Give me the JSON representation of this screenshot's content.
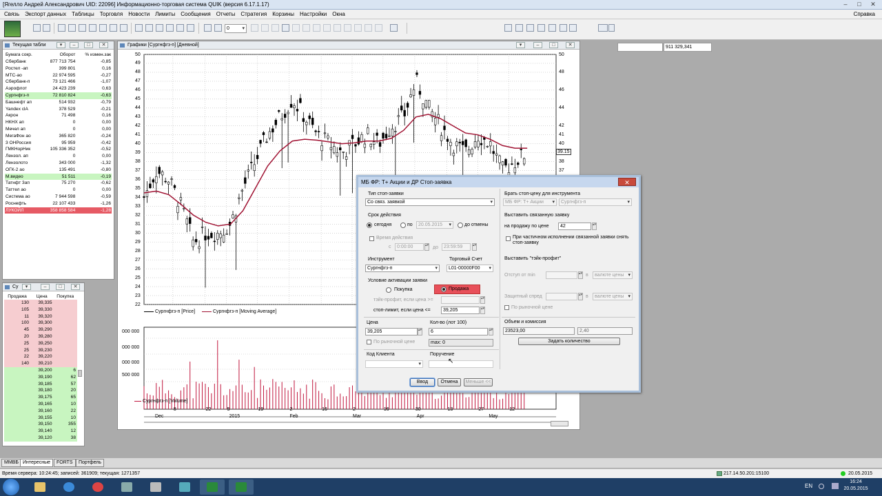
{
  "app": {
    "title": "[Ягелло Андрей Александрович UID: 22096] Информационно-торговая система QUIK (версия 6.17.1.17)",
    "menu": [
      "Связь",
      "Экспорт данных",
      "Таблицы",
      "Торговля",
      "Новости",
      "Лимиты",
      "Сообщения",
      "Отчеты",
      "Стратегия",
      "Корзины",
      "Настройки",
      "Окна"
    ],
    "help": "Справка"
  },
  "toolbar": {
    "combo_value": "0",
    "right_value": "911 329,341"
  },
  "current_table": {
    "title": "Текущая табли",
    "headers": [
      "Бумага сокр.",
      "Оборот",
      "% измен.зак"
    ],
    "rows": [
      {
        "name": "Сбербанк",
        "turnover": "877 713 754",
        "change": "-0,85",
        "hl": ""
      },
      {
        "name": "Ростел -ап",
        "turnover": "399 801",
        "change": "0,16",
        "hl": ""
      },
      {
        "name": "МТС-ао",
        "turnover": "22 974 595",
        "change": "-0,27",
        "hl": ""
      },
      {
        "name": "Сбербанк-п",
        "turnover": "73 121 466",
        "change": "-1,07",
        "hl": ""
      },
      {
        "name": "Аэрофлот",
        "turnover": "24 423 239",
        "change": "0,63",
        "hl": ""
      },
      {
        "name": "Сургнфгз-п",
        "turnover": "72 810 824",
        "change": "-0,63",
        "hl": "green"
      },
      {
        "name": "Башнефт ап",
        "turnover": "514 932",
        "change": "-0,79",
        "hl": ""
      },
      {
        "name": "Yandex clA",
        "turnover": "378 529",
        "change": "-0,21",
        "hl": ""
      },
      {
        "name": "Акрон",
        "turnover": "71 498",
        "change": "0,16",
        "hl": ""
      },
      {
        "name": "НКНХ ап",
        "turnover": "0",
        "change": "0,00",
        "hl": ""
      },
      {
        "name": "Мечел ап",
        "turnover": "0",
        "change": "0,00",
        "hl": ""
      },
      {
        "name": "МегаФон ао",
        "turnover": "365 820",
        "change": "-0,24",
        "hl": ""
      },
      {
        "name": "3 ОНРоссия",
        "turnover": "95 959",
        "change": "-0,42",
        "hl": ""
      },
      {
        "name": "ГМКНорНик",
        "turnover": "105 336 352",
        "change": "-0,52",
        "hl": ""
      },
      {
        "name": "Лензол. ап",
        "turnover": "0",
        "change": "0,00",
        "hl": ""
      },
      {
        "name": "Лензолото",
        "turnover": "343 000",
        "change": "-1,32",
        "hl": ""
      },
      {
        "name": "ОГК-2 ао",
        "turnover": "135 491",
        "change": "-0,80",
        "hl": ""
      },
      {
        "name": "М.видео",
        "turnover": "51 511",
        "change": "-0,19",
        "hl": "green"
      },
      {
        "name": "Татнфт 3ап",
        "turnover": "75 270",
        "change": "-0,62",
        "hl": ""
      },
      {
        "name": "Таттел ао",
        "turnover": "0",
        "change": "0,00",
        "hl": ""
      },
      {
        "name": "Система ао",
        "turnover": "7 944 598",
        "change": "-0,59",
        "hl": ""
      },
      {
        "name": "Роснефть",
        "turnover": "22 107 433",
        "change": "-1,26",
        "hl": ""
      },
      {
        "name": "ЛУКОЙЛ",
        "turnover": "358 858 584",
        "change": "-1,28",
        "hl": "red"
      }
    ]
  },
  "orderbook": {
    "title": "Су",
    "headers": [
      "Продажа",
      "Цена",
      "Покупка"
    ],
    "rows": [
      {
        "sell": "130",
        "price": "39,335",
        "buy": ""
      },
      {
        "sell": "105",
        "price": "39,330",
        "buy": ""
      },
      {
        "sell": "11",
        "price": "39,320",
        "buy": ""
      },
      {
        "sell": "100",
        "price": "39,300",
        "buy": ""
      },
      {
        "sell": "45",
        "price": "39,290",
        "buy": ""
      },
      {
        "sell": "20",
        "price": "39,280",
        "buy": ""
      },
      {
        "sell": "25",
        "price": "39,250",
        "buy": ""
      },
      {
        "sell": "25",
        "price": "39,230",
        "buy": ""
      },
      {
        "sell": "22",
        "price": "39,220",
        "buy": ""
      },
      {
        "sell": "140",
        "price": "39,210",
        "buy": ""
      },
      {
        "sell": "",
        "price": "39,200",
        "buy": "6"
      },
      {
        "sell": "",
        "price": "39,190",
        "buy": "62"
      },
      {
        "sell": "",
        "price": "39,185",
        "buy": "57"
      },
      {
        "sell": "",
        "price": "39,180",
        "buy": "20"
      },
      {
        "sell": "",
        "price": "39,175",
        "buy": "65"
      },
      {
        "sell": "",
        "price": "39,165",
        "buy": "10"
      },
      {
        "sell": "",
        "price": "39,160",
        "buy": "22"
      },
      {
        "sell": "",
        "price": "39,155",
        "buy": "10"
      },
      {
        "sell": "",
        "price": "39,150",
        "buy": "355"
      },
      {
        "sell": "",
        "price": "39,140",
        "buy": "12"
      },
      {
        "sell": "",
        "price": "39,120",
        "buy": "38"
      }
    ]
  },
  "chart_window": {
    "title": "Графики [Сургнфгз-п] [Дневной]",
    "price_legend": [
      "Сургнфгз-п [Price]",
      "Сургнфгз-п [Moving Average]"
    ],
    "volume_legend": "Сургнфгз-п [Volume]",
    "volume_ticks": [
      "000 000",
      "000 000",
      "000 000",
      "500 000"
    ],
    "price_badge": "39.15",
    "price_ticks": [
      50,
      49,
      48,
      47,
      46,
      45,
      44,
      43,
      42,
      41,
      40,
      39,
      38,
      37,
      36,
      35,
      34,
      33,
      32,
      31,
      30,
      29,
      28,
      27,
      26,
      25,
      24,
      23,
      22
    ],
    "right_ticks": [
      50,
      48,
      46,
      44,
      42,
      41,
      40,
      38,
      37
    ],
    "x_days": [
      {
        "label": "8",
        "x": 0.07
      },
      {
        "label": "22",
        "x": 0.148
      },
      {
        "label": "5",
        "x": 0.2
      },
      {
        "label": "19",
        "x": 0.275
      },
      {
        "label": "2",
        "x": 0.352
      },
      {
        "label": "16",
        "x": 0.43
      },
      {
        "label": "2",
        "x": 0.505
      },
      {
        "label": "16",
        "x": 0.58
      },
      {
        "label": "30",
        "x": 0.657
      },
      {
        "label": "13",
        "x": 0.735
      },
      {
        "label": "27",
        "x": 0.81
      },
      {
        "label": "12",
        "x": 0.885
      }
    ],
    "x_months": [
      {
        "label": "Dec",
        "x": 0.025
      },
      {
        "label": "2015",
        "x": 0.205
      },
      {
        "label": "Feb",
        "x": 0.352
      },
      {
        "label": "Mar",
        "x": 0.505
      },
      {
        "label": "Apr",
        "x": 0.66
      },
      {
        "label": "May",
        "x": 0.835
      }
    ]
  },
  "chart_data": {
    "type": "line",
    "title": "",
    "ylim": [
      22,
      50
    ],
    "series": [
      {
        "name": "Сургнфгз-п [Price]",
        "x": [
          0,
          0.03,
          0.06,
          0.09,
          0.12,
          0.15,
          0.18,
          0.21,
          0.24,
          0.27,
          0.3,
          0.33,
          0.36,
          0.39,
          0.42,
          0.45,
          0.48,
          0.51,
          0.54,
          0.57,
          0.6,
          0.63,
          0.66,
          0.69,
          0.72,
          0.75,
          0.78,
          0.81,
          0.84,
          0.87,
          0.9,
          0.93
        ],
        "values": [
          34,
          37,
          36,
          33,
          29,
          30,
          30,
          31,
          35,
          38,
          41,
          43,
          45,
          43,
          41,
          40,
          39,
          40,
          41,
          40,
          42,
          43,
          47,
          44,
          42,
          40,
          39,
          41,
          40,
          37,
          38,
          39
        ]
      },
      {
        "name": "Сургнфгз-п [Moving Average]",
        "x": [
          0,
          0.03,
          0.06,
          0.09,
          0.12,
          0.15,
          0.18,
          0.21,
          0.24,
          0.27,
          0.3,
          0.33,
          0.36,
          0.39,
          0.42,
          0.45,
          0.48,
          0.51,
          0.54,
          0.57,
          0.6,
          0.63,
          0.66,
          0.69,
          0.72,
          0.75,
          0.78,
          0.81,
          0.84,
          0.87,
          0.9,
          0.93
        ],
        "values": [
          34.5,
          34.7,
          34.3,
          33.2,
          32,
          31.2,
          30.8,
          31,
          32.5,
          35,
          37.5,
          39.2,
          40.3,
          40.5,
          40.4,
          40.2,
          40,
          40.1,
          40.3,
          40.3,
          40.6,
          41.5,
          43,
          43.3,
          42.8,
          42,
          41.2,
          41,
          40.5,
          39.8,
          39.5,
          39.5
        ]
      }
    ]
  },
  "dialog": {
    "title": "МБ ФР: Т+ Акции и ДР Стоп-заявка",
    "close": "✕",
    "stop_type_label": "Тип стоп-заявки",
    "stop_type_value": "Со связ. заявкой",
    "term_label": "Срок действия",
    "today": "сегодня",
    "to": "по",
    "date_value": "20.05.2015",
    "until_cancel": "до отмены",
    "time_label": "Время действия",
    "from": "с",
    "time_from": "0:00:00",
    "till": "до",
    "time_to": "23:59:59",
    "instrument_label": "Инструмент",
    "instrument_value": "Сургнфгз-п",
    "account_label": "Торговый Счет",
    "account_value": "L01-00000F00",
    "condition_label": "Условие активации заявки",
    "buy": "Покупка",
    "sell": "Продажа",
    "take_profit_cond": "тэйк-профит, если цена >=",
    "stop_limit_cond": "стоп-лимит, если цена <=",
    "stop_price": "39,205",
    "price_label": "Цена",
    "price_value": "39,205",
    "qty_label": "Кол-во (лот 100)",
    "qty_value": "6",
    "market_price": "По рыночной цене",
    "max_label": "max: 0",
    "client_code_label": "Код Клиента",
    "comment_label": "Поручение",
    "ok": "Ввод",
    "cancel": "Отмена",
    "less": "Меньше <<",
    "take_price_label": "Брать стоп-цену для инструмента",
    "take_price_class": "МБ ФР: Т+ Акции",
    "take_price_instr": "Сургнфгз-п",
    "linked_label": "Выставить связанную заявку",
    "sell_price_label": "на продажу по цене",
    "sell_price_value": "42",
    "partial_label": "При частичном исполнении связанной заявки снять стоп-заявку",
    "take_profit_label": "Выставить \"тэйк-профит\"",
    "offset_label": "Отступ от min",
    "spread_label": "Защитный спред",
    "unit": "в",
    "unit_value": "валюте цены",
    "market_price2": "По рыночной цене",
    "volume_label": "Объем и комиссия",
    "volume_value": "23523,00",
    "commission_value": "2,40",
    "set_qty": "Задать количество"
  },
  "tabs": [
    "ММВБ",
    "Интересные",
    "FORTS",
    "Портфель"
  ],
  "status": {
    "left": "Время сервера: 10:24:45; записей: 361909; текущая: 1271357",
    "connection": "217.14.50.201:15100",
    "date": "20.05.2015"
  },
  "taskbar": {
    "lang": "EN",
    "time": "16:24",
    "date": "20.05.2015"
  },
  "colors": {
    "accent": "#c0143c",
    "buy_bg": "#c8f5c0",
    "sell_bg": "#f6cdd0",
    "ma_line": "#a01232",
    "candle": "#000000"
  }
}
